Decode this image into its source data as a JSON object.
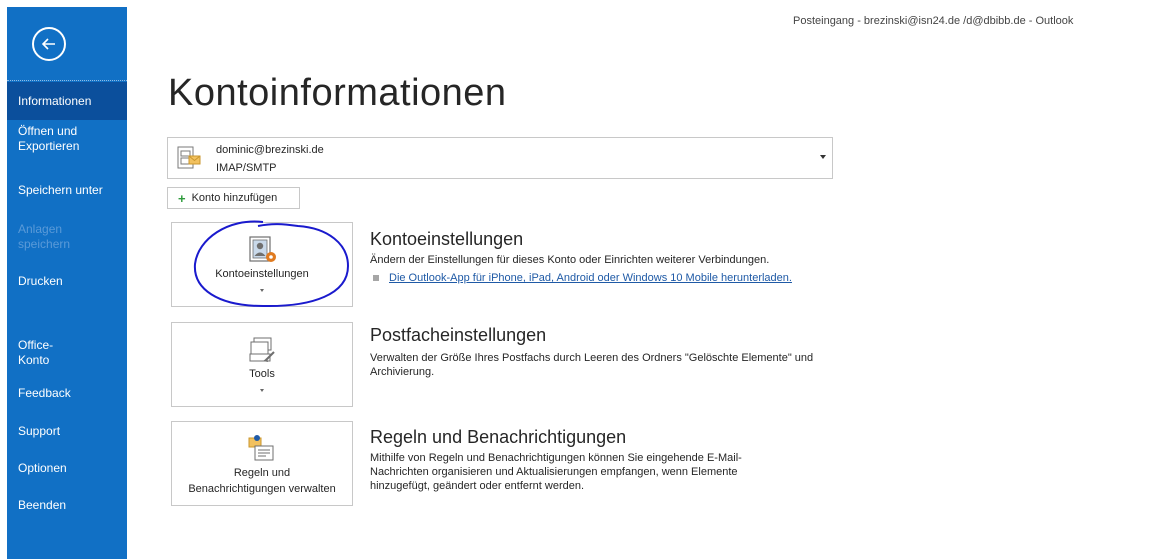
{
  "window_title": "Posteingang - brezinski@isn24.de /d@dbibb.de  -  Outlook",
  "sidebar": {
    "back_icon": "back-arrow-icon",
    "items": [
      {
        "label": "Informationen",
        "active": true
      },
      {
        "label": "Öffnen und Exportieren"
      },
      {
        "label": "Speichern unter"
      },
      {
        "label": "Anlagen speichern",
        "disabled": true
      },
      {
        "label": "Drucken"
      },
      {
        "label": "Office-Konto"
      },
      {
        "label": "Feedback"
      },
      {
        "label": "Support"
      },
      {
        "label": "Optionen"
      },
      {
        "label": "Beenden"
      }
    ]
  },
  "page_title": "Kontoinformationen",
  "account": {
    "email": "dominic@brezinski.de",
    "type": "IMAP/SMTP"
  },
  "add_account_label": "Konto hinzufügen",
  "sections": [
    {
      "tile_label": "Kontoeinstellungen",
      "title": "Kontoeinstellungen",
      "description": "Ändern der Einstellungen für dieses Konto oder Einrichten weiterer Verbindungen.",
      "link": "Die Outlook-App für iPhone, iPad, Android oder Windows 10 Mobile herunterladen."
    },
    {
      "tile_label": "Tools",
      "title": "Postfacheinstellungen",
      "description": "Verwalten der Größe Ihres Postfachs durch Leeren des Ordners \"Gelöschte Elemente\" und Archivierung."
    },
    {
      "tile_label_line1": "Regeln und",
      "tile_label_line2": "Benachrichtigungen verwalten",
      "title": "Regeln und Benachrichtigungen",
      "description": "Mithilfe von Regeln und Benachrichtigungen können Sie eingehende E-Mail-Nachrichten organisieren und Aktualisierungen empfangen, wenn Elemente hinzugefügt, geändert oder entfernt werden."
    }
  ],
  "colors": {
    "sidebar": "#1170c5",
    "sidebar_active": "#0b4f9c",
    "link": "#1f5aa6",
    "annotation": "#1a1acd"
  }
}
